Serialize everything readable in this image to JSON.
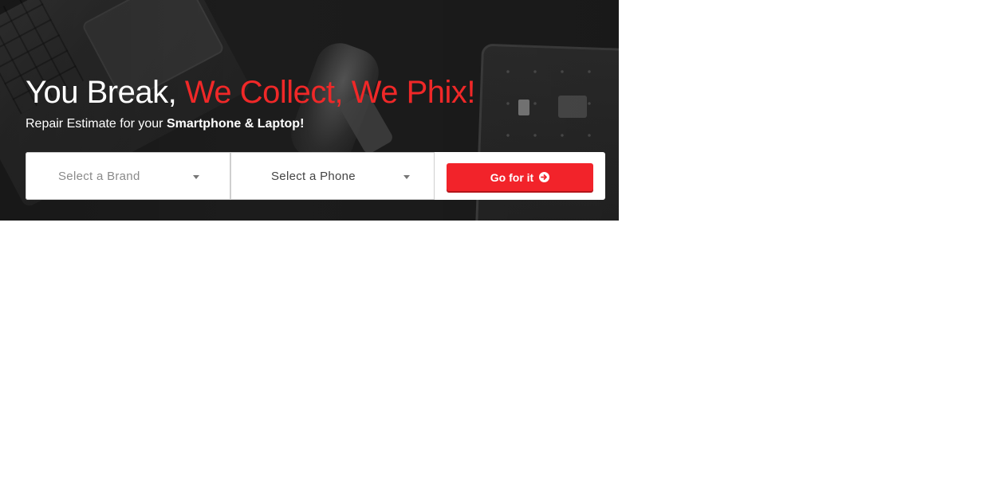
{
  "hero": {
    "headline_plain": "You Break, ",
    "headline_accent": "We Collect, We Phix!",
    "subline_plain": "Repair Estimate for your ",
    "subline_bold": "Smartphone & Laptop!"
  },
  "search": {
    "brand_placeholder": "Select a Brand",
    "phone_placeholder": "Select a Phone",
    "submit_label": "Go for it",
    "submit_icon": "arrow-circle-right-icon"
  },
  "colors": {
    "accent": "#f02828",
    "button": "#f2232a",
    "hero_background": "#1c1c1c"
  }
}
